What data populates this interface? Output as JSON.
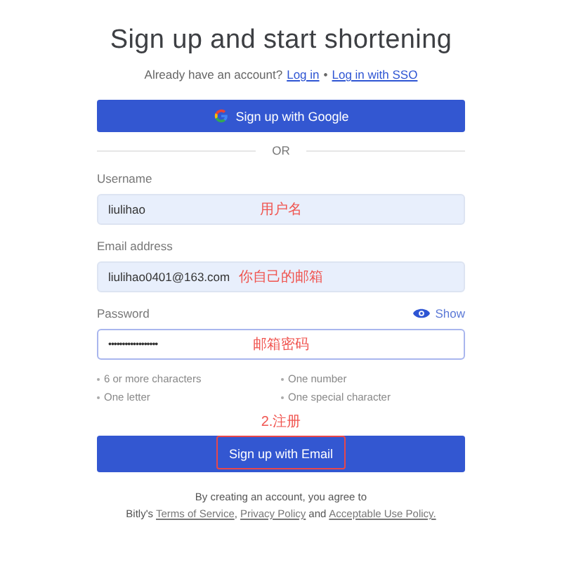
{
  "title": "Sign up and start shortening",
  "login_prompt": {
    "text": "Already have an account?",
    "links": [
      "Log in",
      "Log in with SSO"
    ],
    "separator": "•"
  },
  "google_button": {
    "label": "Sign up with Google"
  },
  "divider": "OR",
  "fields": [
    {
      "label": "Username",
      "value": "liulihao",
      "annotation": "用户名",
      "kind": "text"
    },
    {
      "label": "Email address",
      "value": "liulihao0401@163.com",
      "annotation": "你自己的邮箱",
      "kind": "text"
    },
    {
      "label": "Password",
      "value": "••••••••••••••••••",
      "annotation": "邮箱密码",
      "kind": "password",
      "toggle": "Show"
    }
  ],
  "requirements": [
    "6 or more characters",
    "One number",
    "One letter",
    "One special character"
  ],
  "step_annotation": "2.注册",
  "submit_button": {
    "label": "Sign up with Email",
    "highlighted": true
  },
  "terms": {
    "line1": "By creating an account, you agree to",
    "prefix": "Bitly's",
    "links": [
      "Terms of Service",
      "Privacy Policy",
      "Acceptable Use Policy."
    ],
    "comma": ",",
    "and": "and"
  }
}
